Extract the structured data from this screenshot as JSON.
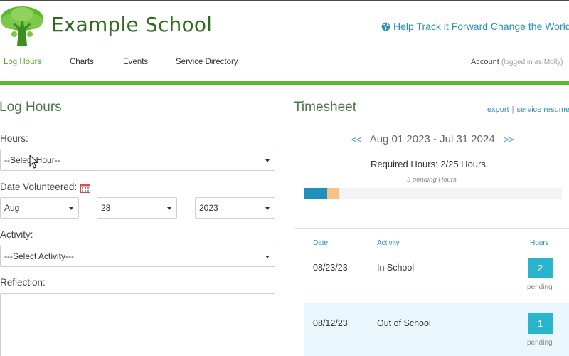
{
  "header": {
    "school_name": "Example School",
    "help_link": "Help Track it Forward Change the World",
    "logo_icon": "tree-logo",
    "help_icon": "globe-icon"
  },
  "nav": {
    "items": [
      {
        "label": "Log Hours",
        "active": true
      },
      {
        "label": "Charts",
        "active": false
      },
      {
        "label": "Events",
        "active": false
      },
      {
        "label": "Service Directory",
        "active": false
      }
    ],
    "account_label": "Account",
    "account_user": "(logged in as Molly)"
  },
  "log_hours": {
    "title": "Log Hours",
    "hours_label": "Hours:",
    "hours_value": "--Select Hour--",
    "date_label": "Date Volunteered:",
    "date_icon": "calendar-icon",
    "month_value": "Aug",
    "day_value": "28",
    "year_value": "2023",
    "activity_label": "Activity:",
    "activity_value": "---Select Activity---",
    "reflection_label": "Reflection:"
  },
  "timesheet": {
    "title": "Timesheet",
    "export_link": "export",
    "resume_link": "service resume",
    "prev_arrow": "<<",
    "next_arrow": ">>",
    "period": "Aug 01 2023 - Jul 31 2024",
    "required_hours": "Required Hours: 2/25 Hours",
    "pending_note": "3 pending Hours",
    "progress": {
      "completed_hours": 0,
      "pending_hours": 3,
      "required_hours": 25
    },
    "columns": {
      "date": "Date",
      "activity": "Activity",
      "hours": "Hours"
    },
    "rows": [
      {
        "date": "08/23/23",
        "activity": "In School",
        "hours": "2",
        "status": "pending"
      },
      {
        "date": "08/12/23",
        "activity": "Out of School",
        "hours": "1",
        "status": "pending"
      }
    ]
  },
  "colors": {
    "brand_green": "#5cb82e",
    "link_blue": "#2a8fb5",
    "badge_teal": "#2ab5cf",
    "progress_done": "#1e8fbf",
    "progress_pending": "#f5c283"
  }
}
